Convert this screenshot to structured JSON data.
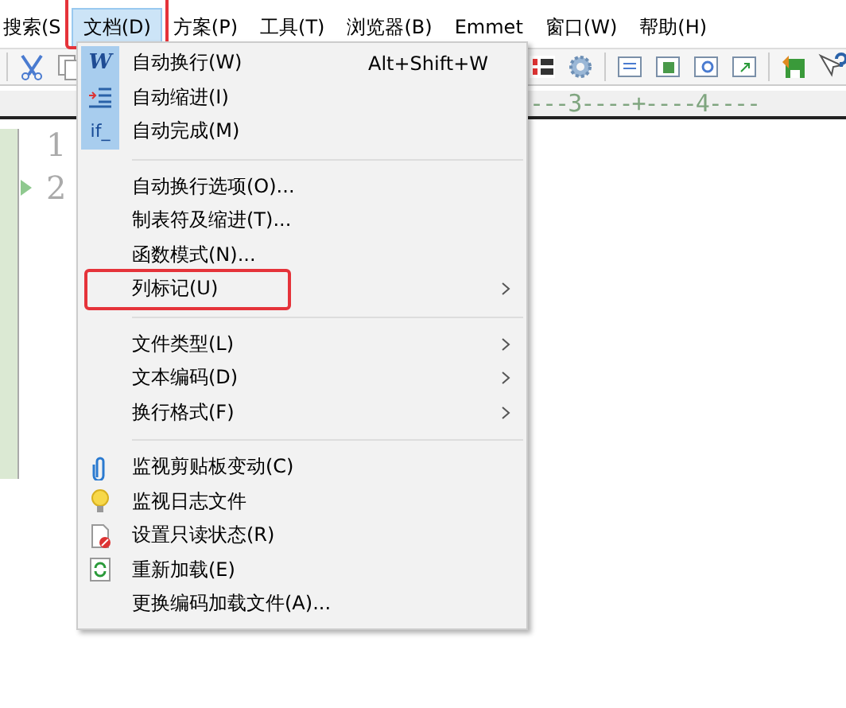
{
  "menubar": [
    {
      "label": "搜索(S",
      "selected": false,
      "highlighted": false
    },
    {
      "label": "文档(D)",
      "selected": true,
      "highlighted": true
    },
    {
      "label": "方案(P)",
      "selected": false,
      "highlighted": false
    },
    {
      "label": "工具(T)",
      "selected": false,
      "highlighted": false
    },
    {
      "label": "浏览器(B)",
      "selected": false,
      "highlighted": false
    },
    {
      "label": "Emmet",
      "selected": false,
      "highlighted": false
    },
    {
      "label": "窗口(W)",
      "selected": false,
      "highlighted": false
    },
    {
      "label": "帮助(H)",
      "selected": false,
      "highlighted": false
    }
  ],
  "ruler": "---3----+----4----",
  "editor": {
    "line_numbers": [
      {
        "number": "1",
        "current": false
      },
      {
        "number": "2",
        "current": true
      }
    ]
  },
  "menu": {
    "groups": [
      [
        {
          "label": "自动换行(W)",
          "shortcut": "Alt+Shift+W",
          "kind": "letter",
          "icon_text": "W",
          "checked": true,
          "submenu": false,
          "highlighted": false
        },
        {
          "label": "自动缩进(I)",
          "kind": "indent",
          "checked": true,
          "submenu": false,
          "highlighted": false
        },
        {
          "label": "自动完成(M)",
          "kind": "letter",
          "icon_text": "if_",
          "checked": true,
          "submenu": false,
          "highlighted": false
        }
      ],
      [
        {
          "label": "自动换行选项(O)...",
          "checked": false,
          "submenu": false,
          "highlighted": false
        },
        {
          "label": "制表符及缩进(T)...",
          "checked": false,
          "submenu": false,
          "highlighted": false
        },
        {
          "label": "函数模式(N)...",
          "checked": false,
          "submenu": false,
          "highlighted": false
        },
        {
          "label": "列标记(U)",
          "checked": false,
          "submenu": true,
          "highlighted": true
        }
      ],
      [
        {
          "label": "文件类型(L)",
          "checked": false,
          "submenu": true,
          "highlighted": false
        },
        {
          "label": "文本编码(D)",
          "checked": false,
          "submenu": true,
          "highlighted": false
        },
        {
          "label": "换行格式(F)",
          "checked": false,
          "submenu": true,
          "highlighted": false
        }
      ],
      [
        {
          "label": "监视剪贴板变动(C)",
          "kind": "paperclip",
          "checked": false,
          "submenu": false,
          "highlighted": false
        },
        {
          "label": "监视日志文件",
          "kind": "bulb",
          "checked": false,
          "submenu": false,
          "highlighted": false
        },
        {
          "label": "设置只读状态(R)",
          "kind": "readonly",
          "checked": false,
          "submenu": false,
          "highlighted": false
        },
        {
          "label": "重新加载(E)",
          "kind": "reload",
          "checked": false,
          "submenu": false,
          "highlighted": false
        },
        {
          "label": "更换编码加载文件(A)...",
          "checked": false,
          "submenu": false,
          "highlighted": false
        }
      ]
    ]
  }
}
